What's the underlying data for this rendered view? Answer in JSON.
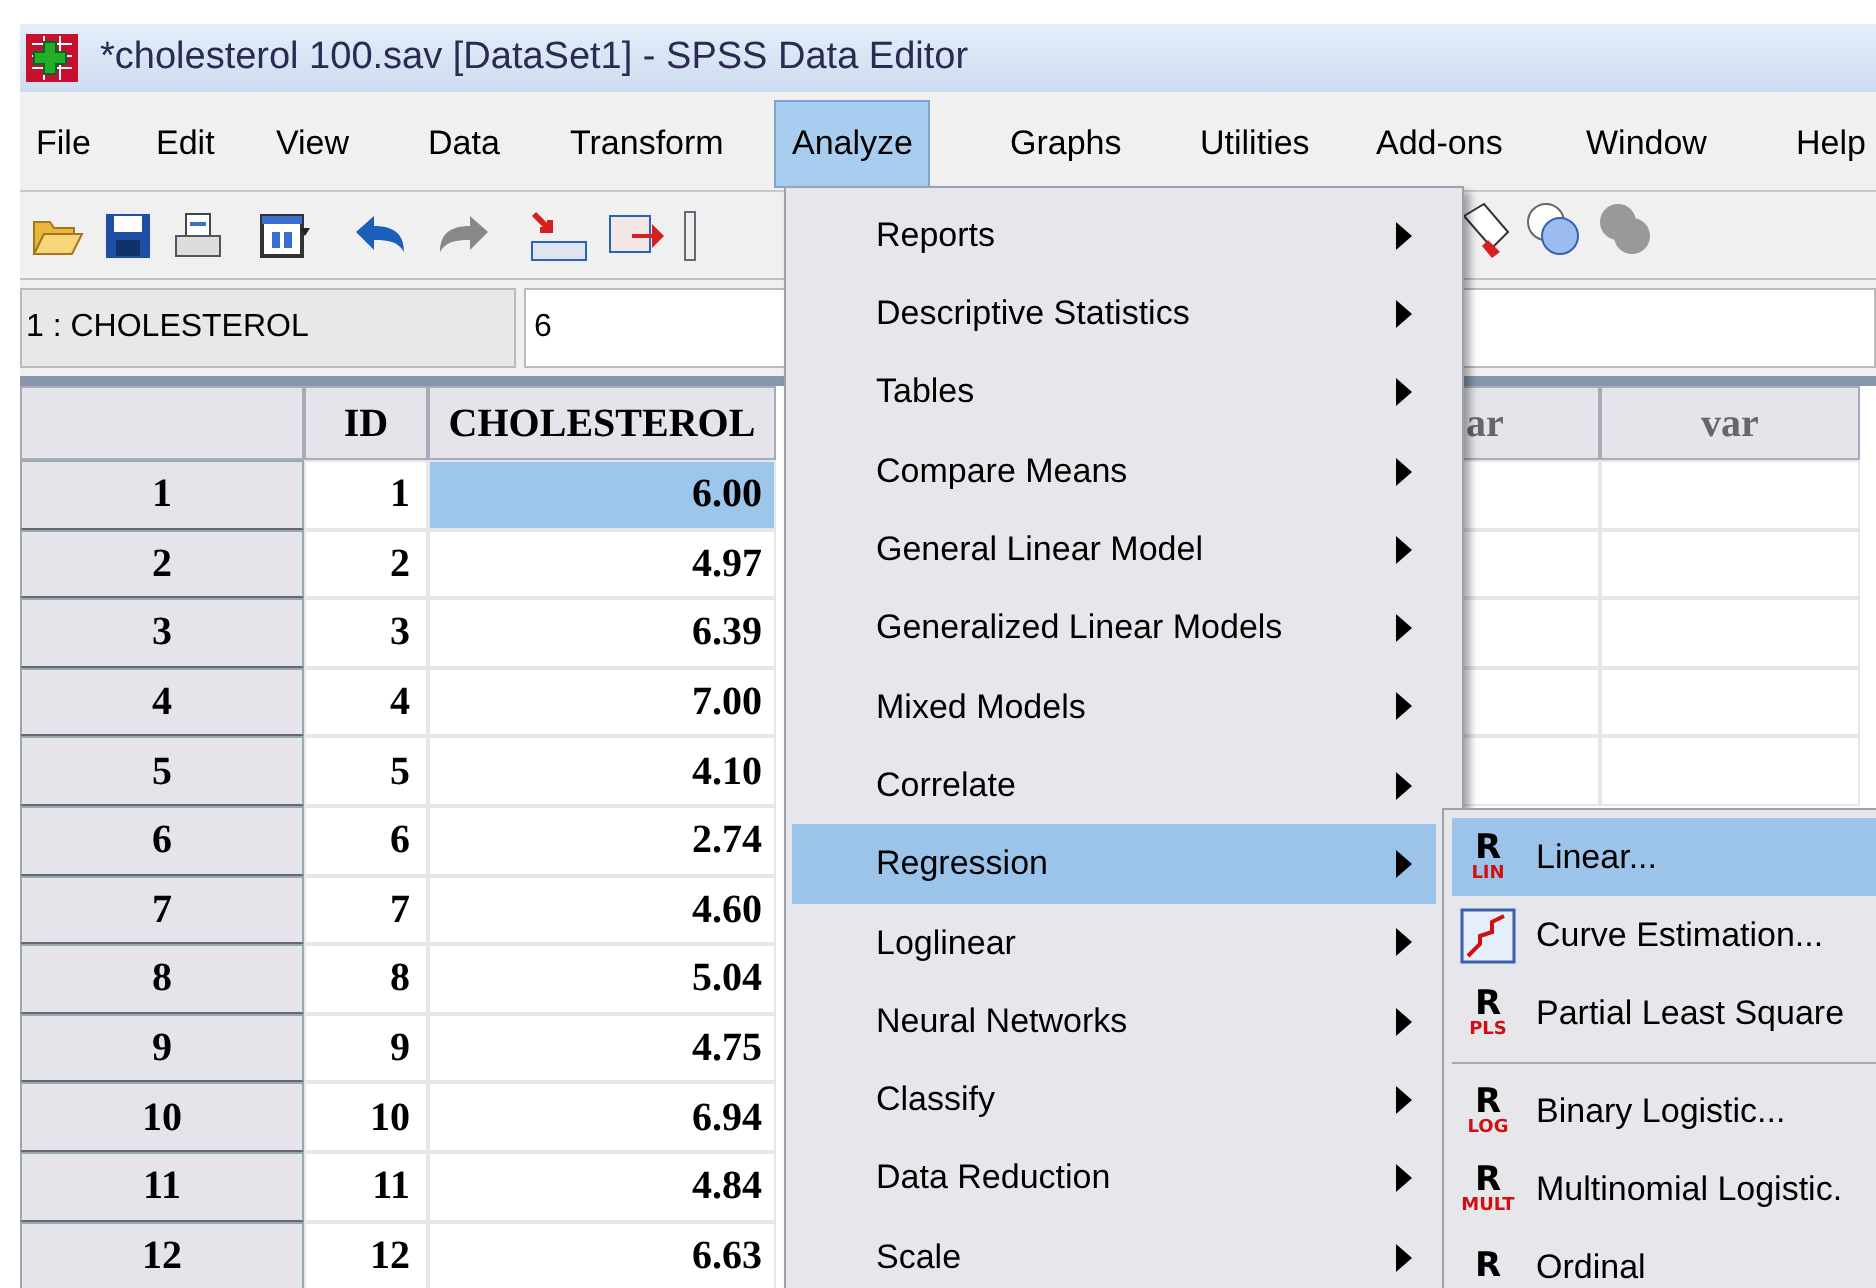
{
  "window": {
    "title": "*cholesterol 100.sav [DataSet1] - SPSS Data Editor"
  },
  "menu_bar": [
    {
      "label": "File",
      "selected": false
    },
    {
      "label": "Edit",
      "selected": false
    },
    {
      "label": "View",
      "selected": false
    },
    {
      "label": "Data",
      "selected": false
    },
    {
      "label": "Transform",
      "selected": false
    },
    {
      "label": "Analyze",
      "selected": true
    },
    {
      "label": "Graphs",
      "selected": false
    },
    {
      "label": "Utilities",
      "selected": false
    },
    {
      "label": "Add-ons",
      "selected": false
    },
    {
      "label": "Window",
      "selected": false
    },
    {
      "label": "Help",
      "selected": false
    }
  ],
  "cell_editor": {
    "cell": "1 : CHOLESTEROL",
    "value": "6"
  },
  "grid": {
    "columns": [
      "ID",
      "CHOLESTEROL",
      "ar",
      "var"
    ],
    "rows": [
      {
        "row": "1",
        "id": "1",
        "cholesterol": "6.00",
        "selected": true
      },
      {
        "row": "2",
        "id": "2",
        "cholesterol": "4.97",
        "selected": false
      },
      {
        "row": "3",
        "id": "3",
        "cholesterol": "6.39",
        "selected": false
      },
      {
        "row": "4",
        "id": "4",
        "cholesterol": "7.00",
        "selected": false
      },
      {
        "row": "5",
        "id": "5",
        "cholesterol": "4.10",
        "selected": false
      },
      {
        "row": "6",
        "id": "6",
        "cholesterol": "2.74",
        "selected": false
      },
      {
        "row": "7",
        "id": "7",
        "cholesterol": "4.60",
        "selected": false
      },
      {
        "row": "8",
        "id": "8",
        "cholesterol": "5.04",
        "selected": false
      },
      {
        "row": "9",
        "id": "9",
        "cholesterol": "4.75",
        "selected": false
      },
      {
        "row": "10",
        "id": "10",
        "cholesterol": "6.94",
        "selected": false
      },
      {
        "row": "11",
        "id": "11",
        "cholesterol": "4.84",
        "selected": false
      },
      {
        "row": "12",
        "id": "12",
        "cholesterol": "6.63",
        "selected": false
      }
    ]
  },
  "analyze_menu": [
    {
      "label": "Reports",
      "selected": false
    },
    {
      "label": "Descriptive Statistics",
      "selected": false
    },
    {
      "label": "Tables",
      "selected": false
    },
    {
      "label": "Compare Means",
      "selected": false
    },
    {
      "label": "General Linear Model",
      "selected": false
    },
    {
      "label": "Generalized Linear Models",
      "selected": false
    },
    {
      "label": "Mixed Models",
      "selected": false
    },
    {
      "label": "Correlate",
      "selected": false
    },
    {
      "label": "Regression",
      "selected": true
    },
    {
      "label": "Loglinear",
      "selected": false
    },
    {
      "label": "Neural Networks",
      "selected": false
    },
    {
      "label": "Classify",
      "selected": false
    },
    {
      "label": "Data Reduction",
      "selected": false
    },
    {
      "label": "Scale",
      "selected": false
    }
  ],
  "regression_submenu": [
    {
      "kind": "r_item",
      "letter": "R",
      "icon_text": "LIN",
      "label": "Linear...",
      "selected": true
    },
    {
      "kind": "chart_item",
      "label": "Curve Estimation...",
      "selected": false
    },
    {
      "kind": "r_item",
      "letter": "R",
      "icon_text": "PLS",
      "label": "Partial Least Square",
      "selected": false
    },
    {
      "kind": "separator"
    },
    {
      "kind": "r_item",
      "letter": "R",
      "icon_text": "LOG",
      "label": "Binary Logistic...",
      "selected": false
    },
    {
      "kind": "r_item",
      "letter": "R",
      "icon_text": "MULT",
      "label": "Multinomial Logistic.",
      "selected": false
    },
    {
      "kind": "r_item",
      "letter": "R",
      "label": "Ordinal",
      "selected": false
    }
  ]
}
